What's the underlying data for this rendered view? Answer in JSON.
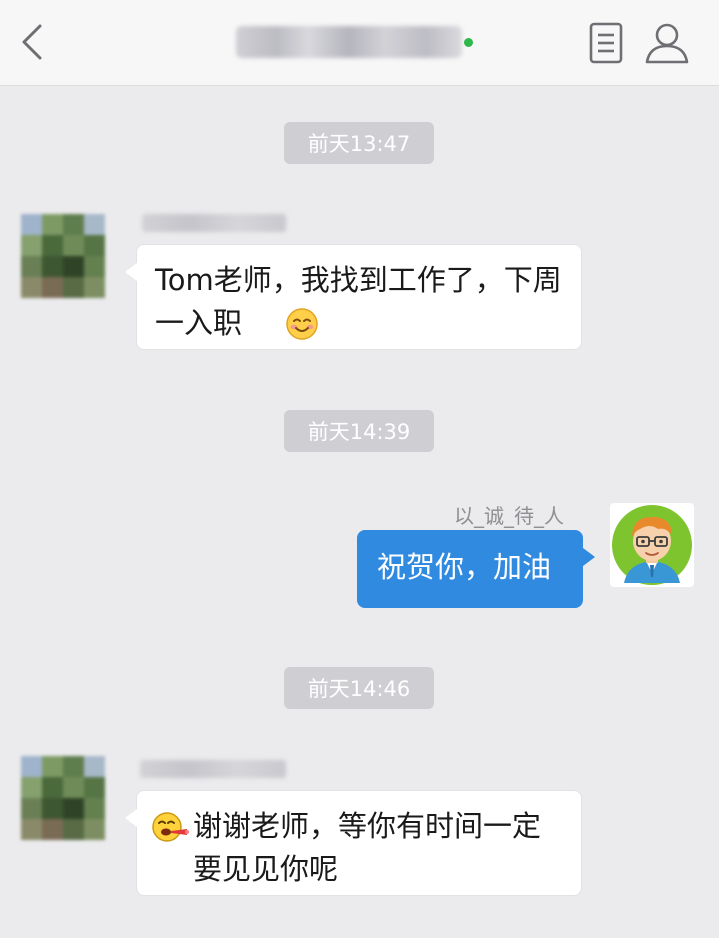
{
  "header": {
    "back_icon": "chevron-left-icon",
    "menu_icon": "document-list-icon",
    "profile_icon": "person-outline-icon",
    "status_color": "#2fb84a"
  },
  "messages": [
    {
      "type": "time",
      "text": "前天13:47"
    },
    {
      "type": "incoming",
      "text": "Tom老师，我找到工作了，下周一入职",
      "emoji": "smiling-face-icon"
    },
    {
      "type": "time",
      "text": "前天14:39"
    },
    {
      "type": "outgoing",
      "sender": "以_诚_待_人",
      "text": "祝贺你，加油",
      "avatar": "cartoon-man-glasses-avatar"
    },
    {
      "type": "time",
      "text": "前天14:46"
    },
    {
      "type": "incoming",
      "text": "谢谢老师，等你有时间一定要见见你呢",
      "emoji": "party-face-icon"
    }
  ],
  "theme": {
    "outgoing_bubble": "#2f8ae0",
    "incoming_bubble": "#ffffff",
    "background": "#ebebed",
    "time_chip": "#cfcfd3"
  }
}
